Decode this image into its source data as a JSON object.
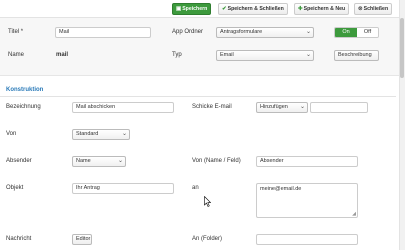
{
  "toolbar": {
    "save_label": "Speichern",
    "save_close_label": "Speichern & Schließen",
    "save_new_label": "Speichern & Neu",
    "close_label": "Schließen"
  },
  "details": {
    "title_label": "Titel",
    "title_required_marker": "*",
    "title_value": "Mail",
    "name_label": "Name",
    "name_value": "mail",
    "app_folder_label": "App Ordner",
    "app_folder_value": "Antragsformulare",
    "toggle_on": "On",
    "toggle_off": "Off",
    "type_label": "Typ",
    "type_value": "Email",
    "description_button": "Beschreibung"
  },
  "section": {
    "title": "Konstruktion"
  },
  "form": {
    "bezeichnung_label": "Bezeichnung",
    "bezeichnung_value": "Mail abschicken",
    "send_email_label": "Schicke E-mail",
    "send_email_select": "Hinzufügen",
    "von_label": "Von",
    "von_value": "Standard",
    "absender_label": "Absender",
    "absender_select": "Name",
    "von_name_label": "Von (Name / Feld)",
    "von_name_value": "Absender",
    "objekt_label": "Objekt",
    "objekt_value": "Ihr Antrag",
    "an_label": "an",
    "an_value": "meine@email.de",
    "nachricht_label": "Nachricht",
    "editor_button": "Editor",
    "an_folder_label": "An (Folder)"
  },
  "icons": {
    "save": "save-icon",
    "save_close": "check-icon",
    "save_new": "plus-icon",
    "close": "close-icon",
    "dropdown": "chevron-down-icon"
  },
  "colors": {
    "primary_green": "#3d9a3d",
    "section_blue": "#2a7ab8"
  }
}
